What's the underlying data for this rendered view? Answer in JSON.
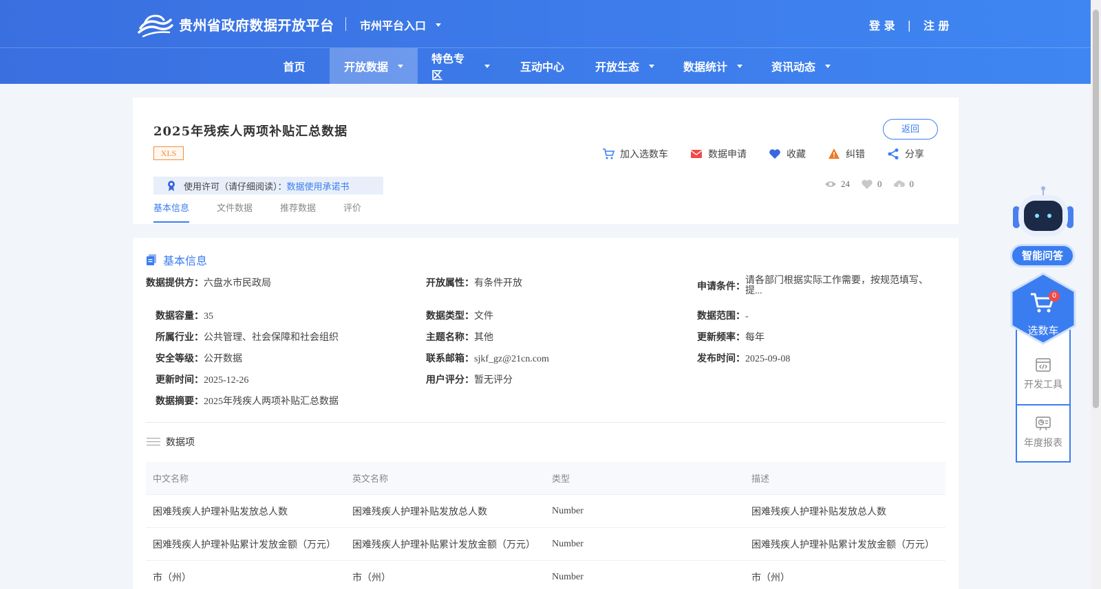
{
  "header": {
    "logo_text": "贵州省政府数据开放平台",
    "city_entry": "市州平台入口",
    "login": "登 录",
    "auth_sep": "|",
    "register": "注 册",
    "nav": [
      {
        "label": "首页",
        "dropdown": false,
        "active": false
      },
      {
        "label": "开放数据",
        "dropdown": true,
        "active": true
      },
      {
        "label": "特色专区",
        "dropdown": true,
        "active": false
      },
      {
        "label": "互动中心",
        "dropdown": false,
        "active": false
      },
      {
        "label": "开放生态",
        "dropdown": true,
        "active": false
      },
      {
        "label": "数据统计",
        "dropdown": true,
        "active": false
      },
      {
        "label": "资讯动态",
        "dropdown": true,
        "active": false
      }
    ]
  },
  "dataset": {
    "title": "2025年残疾人两项补贴汇总数据",
    "format_tag": "XLS",
    "back_label": "返回",
    "actions": {
      "add_cart": "加入选数车",
      "apply": "数据申请",
      "favorite": "收藏",
      "correct": "纠错",
      "share": "分享"
    },
    "license_label": "使用许可（请仔细阅读）：",
    "license_link": "数据使用承诺书",
    "stats": {
      "views": "24",
      "likes": "0",
      "downloads": "0"
    },
    "tabs": [
      "基本信息",
      "文件数据",
      "推荐数据",
      "评价"
    ]
  },
  "basic_info": {
    "section_title": "基本信息",
    "fields": {
      "provider": {
        "k": "数据提供方：",
        "v": "六盘水市民政局"
      },
      "open_attr": {
        "k": "开放属性：",
        "v": "有条件开放"
      },
      "apply_cond": {
        "k": "申请条件：",
        "v": "请各部门根据实际工作需要，按规范填写、提..."
      },
      "capacity": {
        "k": "数据容量：",
        "v": "35"
      },
      "data_type": {
        "k": "数据类型：",
        "v": "文件"
      },
      "scope": {
        "k": "数据范围：",
        "v": "-"
      },
      "industry": {
        "k": "所属行业：",
        "v": "公共管理、社会保障和社会组织"
      },
      "topic": {
        "k": "主题名称：",
        "v": "其他"
      },
      "frequency": {
        "k": "更新频率：",
        "v": "每年"
      },
      "security": {
        "k": "安全等级：",
        "v": "公开数据"
      },
      "email": {
        "k": "联系邮箱：",
        "v": "sjkf_gz@21cn.com"
      },
      "publish_time": {
        "k": "发布时间：",
        "v": "2025-09-08"
      },
      "update_time": {
        "k": "更新时间：",
        "v": "2025-12-26"
      },
      "rating": {
        "k": "用户评分：",
        "v": "暂无评分"
      },
      "summary": {
        "k": "数据摘要：",
        "v": "2025年残疾人两项补贴汇总数据"
      }
    }
  },
  "data_items": {
    "title": "数据项",
    "headers": [
      "中文名称",
      "英文名称",
      "类型",
      "描述"
    ],
    "rows": [
      [
        "困难残疾人护理补贴发放总人数",
        "困难残疾人护理补贴发放总人数",
        "Number",
        "困难残疾人护理补贴发放总人数"
      ],
      [
        "困难残疾人护理补贴累计发放金额（万元）",
        "困难残疾人护理补贴累计发放金额（万元）",
        "Number",
        "困难残疾人护理补贴累计发放金额（万元）"
      ],
      [
        "市（州）",
        "市（州）",
        "Number",
        "市（州）"
      ]
    ]
  },
  "side": {
    "ai_label": "智能问答",
    "cart_label": "选数车",
    "cart_count": "0",
    "dev_tools": "开发工具",
    "annual_report": "年度报表"
  },
  "colors": {
    "primary": "#3a7df0",
    "header_start": "#3a6fe0",
    "header_end": "#3f86f2",
    "tag": "#f0903c"
  }
}
